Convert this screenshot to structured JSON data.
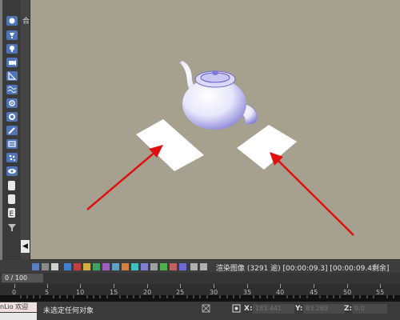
{
  "side_panel": {
    "tab_label": "合"
  },
  "collapse_glyph": "◀",
  "statusbar": {
    "render_status": "渲染图像 (3291 逾) [00:00:09.3] [00:00:09.4剩余]"
  },
  "timeline": {
    "position": "0 / 100",
    "ticks": [
      "0",
      "5",
      "10",
      "15",
      "20",
      "25",
      "30",
      "35",
      "40",
      "45",
      "50",
      "55"
    ]
  },
  "bottom": {
    "mini_text": "nLio 欢迎",
    "selection_text": "未选定任何对象",
    "x_label": "X:",
    "x_value": "183.441",
    "y_label": "Y:",
    "y_value": "83.269",
    "z_label": "Z:",
    "z_value": "0.0"
  },
  "colors": {
    "arrow": "#e01010",
    "viewport_bg": "#a6a08f",
    "tool_blue": "#4f74b8"
  },
  "icons": [
    "sphere-icon",
    "lamp-icon",
    "camera-icon",
    "ruler-icon",
    "wave-icon",
    "gear-icon",
    "dial-icon",
    "brush-icon",
    "box-icon",
    "particle-icon",
    "eye-icon",
    "page-icon",
    "filter-icon"
  ]
}
